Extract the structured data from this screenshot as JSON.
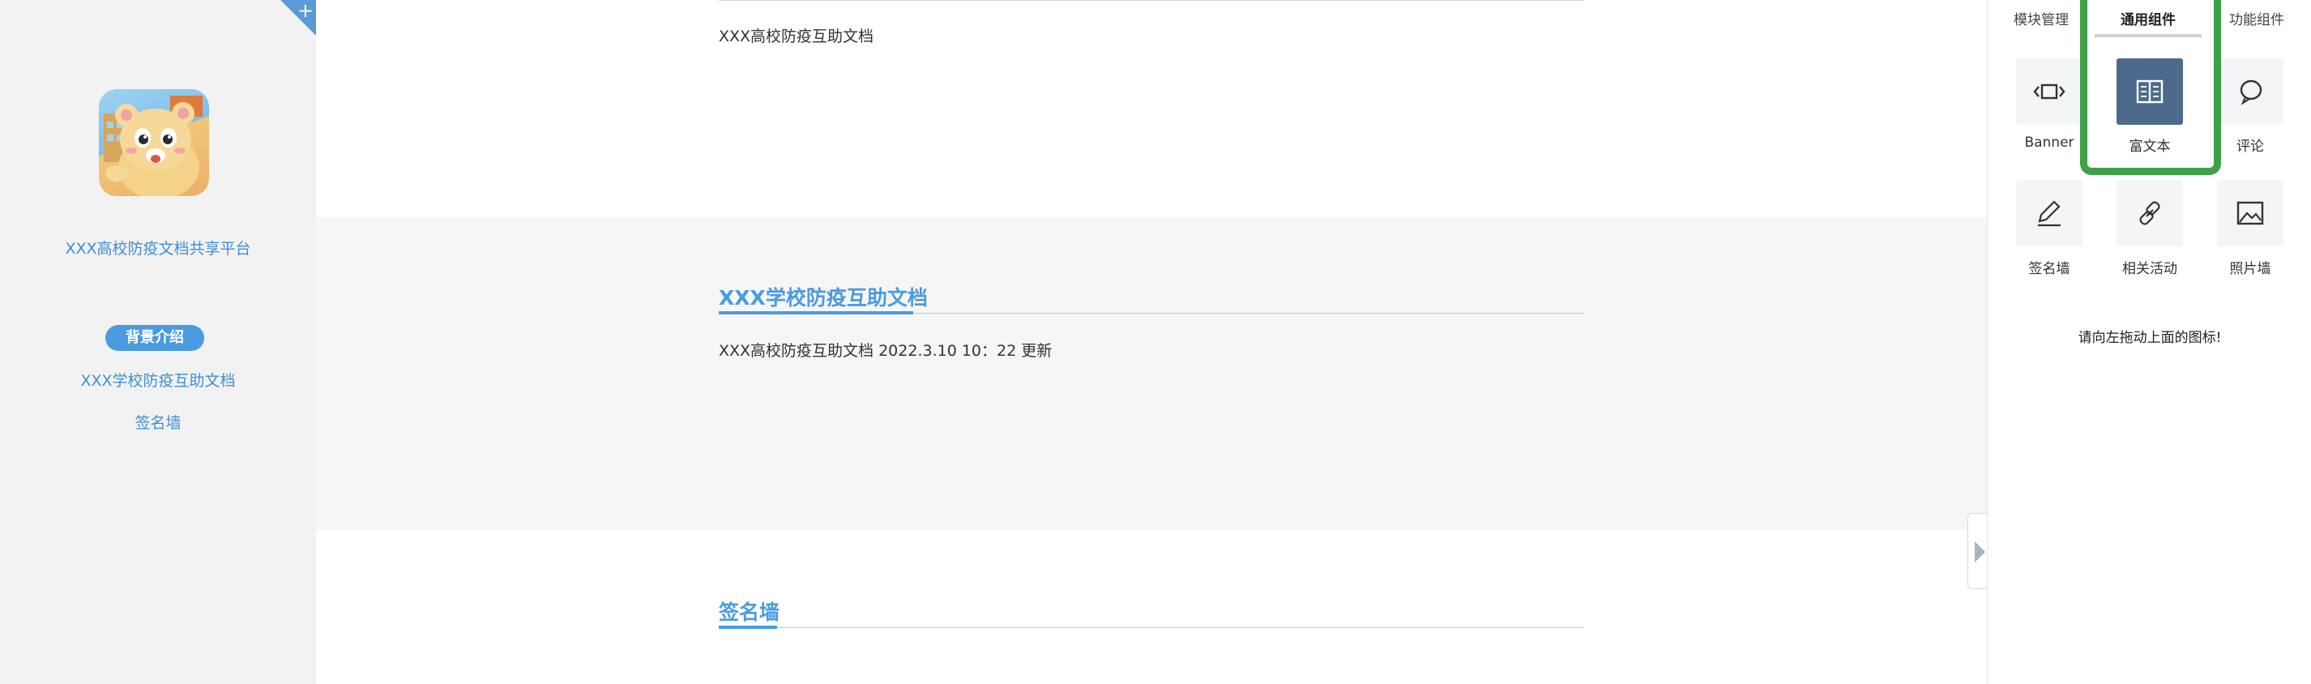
{
  "sidebar": {
    "add_icon": "plus-icon",
    "logo_icon": "cartoon-bear-logo",
    "site_title": "XXX高校防疫文档共享平台",
    "nav": {
      "active_label": "背景介绍",
      "item_1_label": "XXX学校防疫互助文档",
      "item_2_label": "签名墙"
    }
  },
  "main": {
    "top_text": "XXX高校防疫互助文档",
    "section_1": {
      "title": "XXX学校防疫互助文档",
      "body": "XXX高校防疫互助文档  2022.3.10 10：22 更新"
    },
    "section_2": {
      "title": "签名墙"
    }
  },
  "panel": {
    "tabs": [
      "模块管理",
      "通用组件",
      "功能组件"
    ],
    "active_tab": "通用组件",
    "components": [
      {
        "label": "Banner",
        "icon": "banner-icon"
      },
      {
        "label": "富文本",
        "icon": "rich-text-icon"
      },
      {
        "label": "评论",
        "icon": "comment-icon"
      },
      {
        "label": "签名墙",
        "icon": "pencil-icon"
      },
      {
        "label": "相关活动",
        "icon": "link-icon"
      },
      {
        "label": "照片墙",
        "icon": "image-icon"
      }
    ],
    "hint": "请向左拖动上面的图标!"
  },
  "colors": {
    "accent_blue": "#4a9be0",
    "selected_component": "#4d6a8c",
    "highlight_green": "#3fa047"
  }
}
